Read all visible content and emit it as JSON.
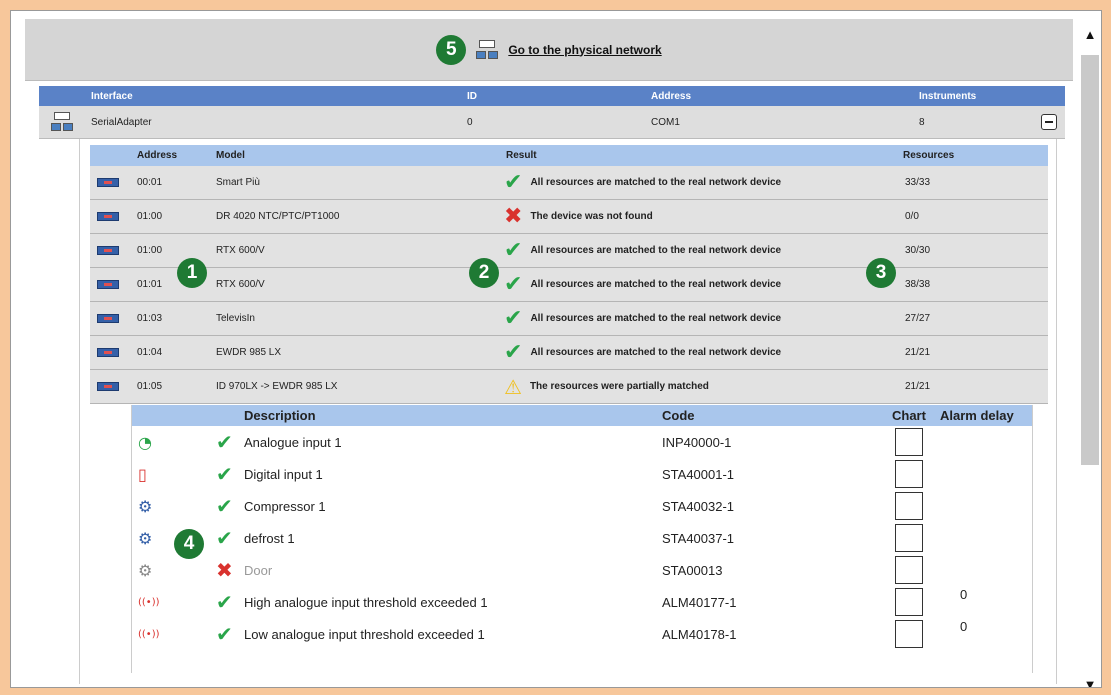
{
  "top_bar": {
    "badge": "5",
    "link_label": "Go to the physical network"
  },
  "interface_table": {
    "headers": {
      "interface": "Interface",
      "id": "ID",
      "address": "Address",
      "instruments": "Instruments"
    },
    "row": {
      "interface": "SerialAdapter",
      "id": "0",
      "address": "COM1",
      "instruments": "8"
    }
  },
  "device_table": {
    "headers": {
      "address": "Address",
      "model": "Model",
      "result": "Result",
      "resources": "Resources"
    },
    "rows": [
      {
        "address": "00:01",
        "model": "Smart Più",
        "status": "ok",
        "result": "All resources are matched to the real network device",
        "resources": "33/33"
      },
      {
        "address": "01:00",
        "model": "DR 4020 NTC/PTC/PT1000",
        "status": "error",
        "result": "The device was not found",
        "resources": "0/0"
      },
      {
        "address": "01:00",
        "model": "RTX 600/V",
        "status": "ok",
        "result": "All resources are matched to the real network device",
        "resources": "30/30"
      },
      {
        "address": "01:01",
        "model": "RTX 600/V",
        "status": "ok",
        "result": "All resources are matched to the real network device",
        "resources": "38/38"
      },
      {
        "address": "01:03",
        "model": "TelevisIn",
        "status": "ok",
        "result": "All resources are matched to the real network device",
        "resources": "27/27"
      },
      {
        "address": "01:04",
        "model": "EWDR 985 LX",
        "status": "ok",
        "result": "All resources are matched to the real network device",
        "resources": "21/21"
      },
      {
        "address": "01:05",
        "model": "ID 970LX -> EWDR 985 LX",
        "status": "warning",
        "result": "The resources were partially matched",
        "resources": "21/21"
      }
    ]
  },
  "resource_table": {
    "headers": {
      "description": "Description",
      "code": "Code",
      "chart": "Chart",
      "alarm_delay": "Alarm delay"
    },
    "rows": [
      {
        "icon": "analogue-input-icon",
        "status": "ok",
        "description": "Analogue input 1",
        "code": "INP40000-1",
        "alarm_delay": ""
      },
      {
        "icon": "digital-input-icon",
        "status": "ok",
        "description": "Digital input 1",
        "code": "STA40001-1",
        "alarm_delay": ""
      },
      {
        "icon": "gear-icon",
        "status": "ok",
        "description": "Compressor 1",
        "code": "STA40032-1",
        "alarm_delay": ""
      },
      {
        "icon": "gear-icon",
        "status": "ok",
        "description": "defrost 1",
        "code": "STA40037-1",
        "alarm_delay": ""
      },
      {
        "icon": "gear-icon",
        "status": "error",
        "description": "Door",
        "code": "STA00013",
        "alarm_delay": ""
      },
      {
        "icon": "alarm-icon",
        "status": "ok",
        "description": "High analogue input threshold exceeded 1",
        "code": "ALM40177-1",
        "alarm_delay": "0"
      },
      {
        "icon": "alarm-icon",
        "status": "ok",
        "description": "Low analogue input threshold exceeded 1",
        "code": "ALM40178-1",
        "alarm_delay": "0"
      }
    ]
  },
  "callouts": [
    "1",
    "2",
    "3",
    "4"
  ],
  "colors": {
    "background": "#f7c79b",
    "header_blue": "#5a82c7",
    "subheader_blue": "#a9c6ec",
    "badge_green": "#1f7a34",
    "check_green": "#2aa54a",
    "error_red": "#d9322e",
    "warning_yellow": "#f0c020"
  }
}
